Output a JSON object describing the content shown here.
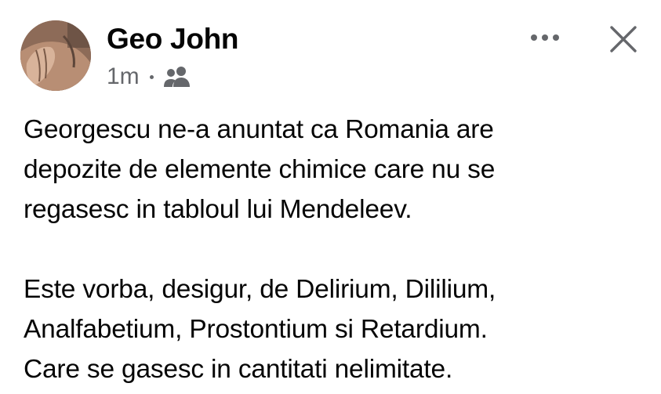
{
  "post": {
    "author": "Geo John",
    "time": "1m",
    "audience_icon": "friends-icon",
    "more_icon": "more-horizontal-icon",
    "close_icon": "close-icon",
    "paragraphs": [
      "Georgescu ne-a anuntat ca Romania are\ndepozite de elemente chimice care nu se\nregasesc in tabloul lui Mendeleev.",
      "Este vorba, desigur, de Delirium, Dililium,\nAnalfabetium, Prostontium si Retardium.\nCare se gasesc in cantitati nelimitate."
    ]
  },
  "colors": {
    "text": "#050505",
    "secondary_text": "#65676b",
    "icon": "#65676b",
    "background": "#ffffff"
  }
}
